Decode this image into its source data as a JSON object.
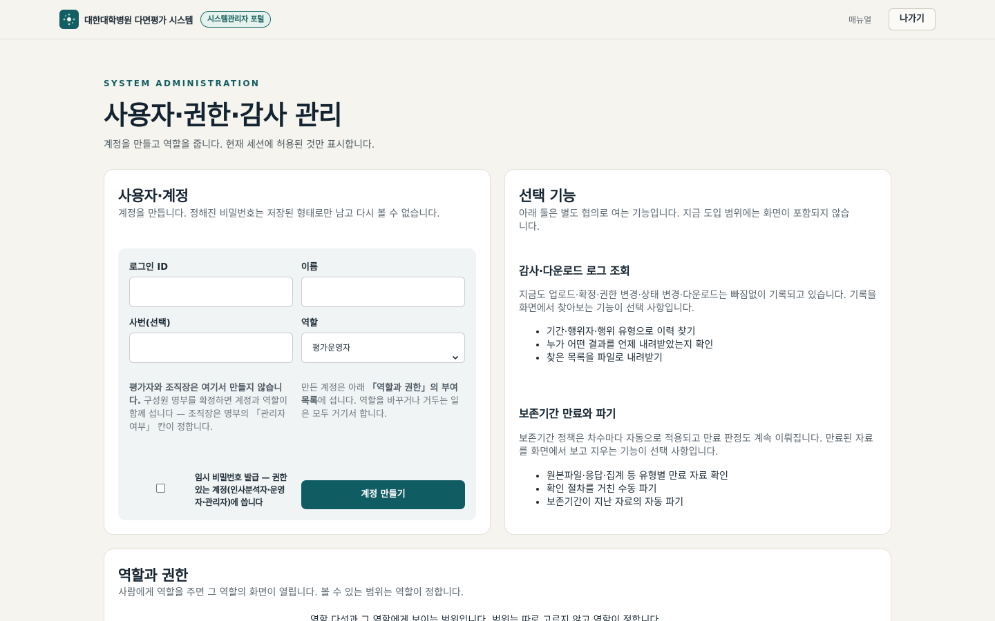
{
  "header": {
    "app_title": "대한대학병원 다면평가 시스템",
    "portal_badge": "시스템관리자 포털",
    "manual_link": "매뉴얼",
    "exit_button": "나가기"
  },
  "page": {
    "eyebrow": "SYSTEM ADMINISTRATION",
    "title": "사용자·권한·감사 관리",
    "subtitle": "계정을 만들고 역할을 줍니다. 현재 세션에 허용된 것만 표시합니다."
  },
  "accounts_card": {
    "title": "사용자·계정",
    "description": "계정을 만듭니다. 정해진 비밀번호는 저장된 형태로만 남고 다시 볼 수 없습니다.",
    "form": {
      "login_id_label": "로그인 ID",
      "login_id_value": "",
      "name_label": "이름",
      "name_value": "",
      "employee_no_label": "사번(선택)",
      "employee_no_value": "",
      "role_label": "역할",
      "role_selected": "평가운영자",
      "note_left_bold": "평가자와 조직장은 여기서 만들지 않습니다.",
      "note_left_rest": " 구성원 명부를 확정하면 계정과 역할이 함께 섭니다 — 조직장은 명부의 「관리자 여부」 칸이 정합니다.",
      "note_right_pre": "만든 계정은 아래 ",
      "note_right_bold": "「역할과 권한」의 부여 목록",
      "note_right_post": "에 섭니다. 역할을 바꾸거나 거두는 일은 모두 거기서 합니다.",
      "temp_password_label": "임시 비밀번호 발급 — 권한 있는 계정(인사분석자·운영자·관리자)에 씁니다",
      "create_button": "계정 만들기"
    }
  },
  "optional_card": {
    "title": "선택 기능",
    "description": "아래 둘은 별도 협의로 여는 기능입니다. 지금 도입 범위에는 화면이 포함되지 않습니다.",
    "audit": {
      "heading": "감사·다운로드 로그 조회",
      "text": "지금도 업로드·확정·권한 변경·상태 변경·다운로드는 빠짐없이 기록되고 있습니다. 기록을 화면에서 찾아보는 기능이 선택 사항입니다.",
      "items": [
        "기간·행위자·행위 유형으로 이력 찾기",
        "누가 어떤 결과를 언제 내려받았는지 확인",
        "찾은 목록을 파일로 내려받기"
      ]
    },
    "retention": {
      "heading": "보존기간 만료와 파기",
      "text": "보존기간 정책은 차수마다 자동으로 적용되고 만료 판정도 계속 이뤄집니다. 만료된 자료를 화면에서 보고 지우는 기능이 선택 사항입니다.",
      "items": [
        "원본파일·응답·집계 등 유형별 만료 자료 확인",
        "확인 절차를 거친 수동 파기",
        "보존기간이 지난 자료의 자동 파기"
      ]
    }
  },
  "roles_card": {
    "title": "역할과 권한",
    "description": "사람에게 역할을 주면 그 역할의 화면이 열립니다. 볼 수 있는 범위는 역할이 정합니다.",
    "cutoff_text": "역할 다섯과 그 역할에게 보이는 범위입니다. 범위는 따로 고르지 않고 역할이 정합니다."
  },
  "colors": {
    "brand_teal": "#0f5c62",
    "background": "#f6f4ee",
    "card": "#ffffff"
  }
}
